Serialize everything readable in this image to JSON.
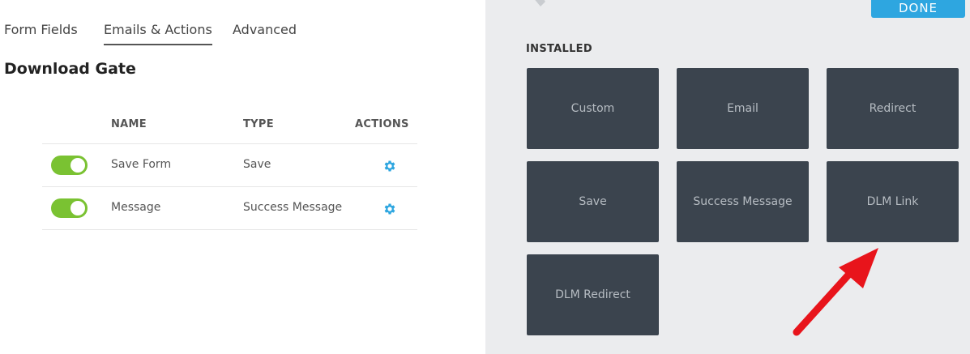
{
  "tabs": [
    {
      "label": "Form Fields"
    },
    {
      "label": "Emails & Actions"
    },
    {
      "label": "Advanced"
    }
  ],
  "form_title": "Download Gate",
  "table": {
    "headers": {
      "name": "NAME",
      "type": "TYPE",
      "actions": "ACTIONS"
    },
    "rows": [
      {
        "name": "Save Form",
        "type": "Save",
        "enabled": true
      },
      {
        "name": "Message",
        "type": "Success Message",
        "enabled": true
      }
    ]
  },
  "right_panel": {
    "done_label": "DONE",
    "installed_heading": "INSTALLED",
    "actions": [
      {
        "label": "Custom"
      },
      {
        "label": "Email"
      },
      {
        "label": "Redirect"
      },
      {
        "label": "Save"
      },
      {
        "label": "Success Message"
      },
      {
        "label": "DLM Link"
      },
      {
        "label": "DLM Redirect"
      }
    ]
  },
  "colors": {
    "toggle_on": "#7ac232",
    "gear": "#2ea6e0",
    "tile_bg": "#3b444e",
    "panel_bg": "#ebecee",
    "done_button": "#2ea6e0",
    "annotation_arrow": "#e8141b"
  },
  "icons": {
    "actions_gear": "gear-icon",
    "top_tool": "wrench-icon"
  }
}
